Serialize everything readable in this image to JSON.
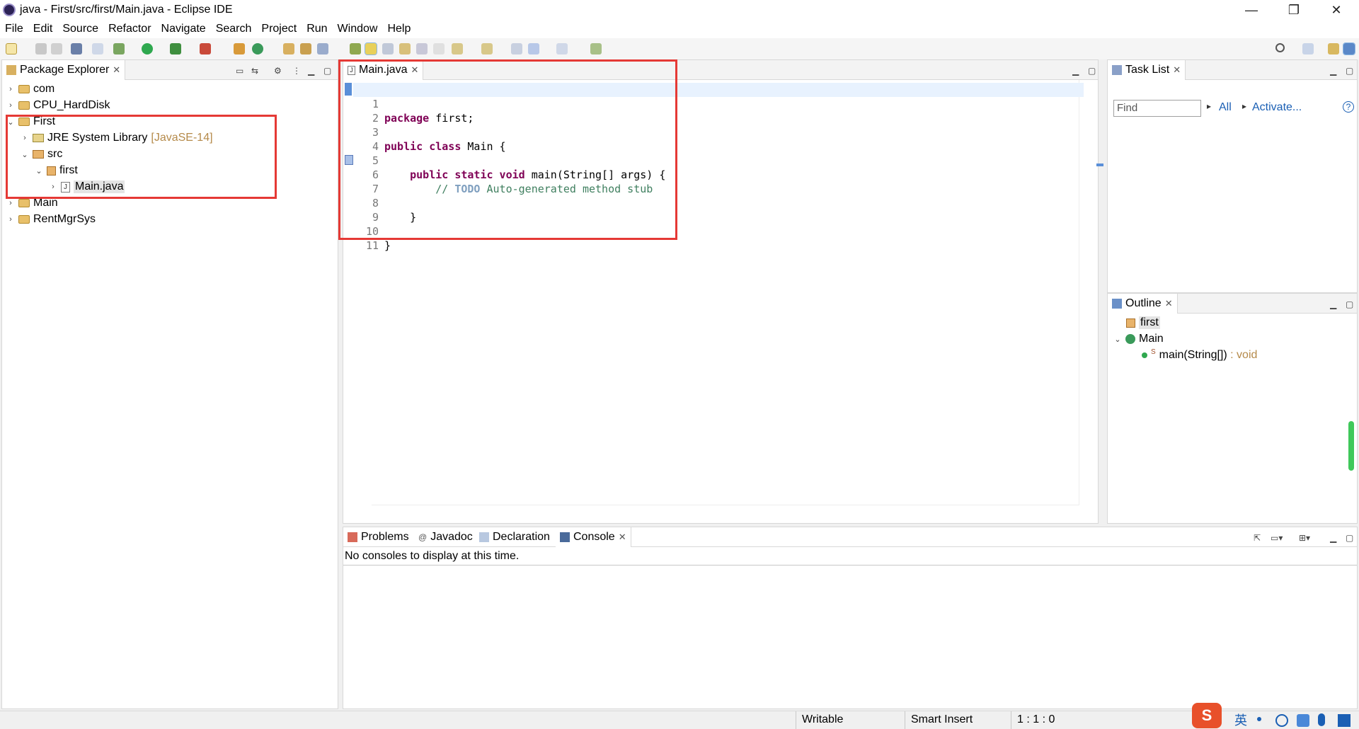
{
  "window": {
    "title": "java - First/src/first/Main.java - Eclipse IDE",
    "minimize": "—",
    "restore": "❐",
    "close": "✕"
  },
  "menu": [
    "File",
    "Edit",
    "Source",
    "Refactor",
    "Navigate",
    "Search",
    "Project",
    "Run",
    "Window",
    "Help"
  ],
  "package_explorer": {
    "tab_label": "Package Explorer",
    "items": [
      {
        "label": "com"
      },
      {
        "label": "CPU_HardDisk"
      },
      {
        "label": "First"
      },
      {
        "label": "JRE System Library",
        "decoration": "[JavaSE-14]"
      },
      {
        "label": "src"
      },
      {
        "label": "first"
      },
      {
        "label": "Main.java"
      },
      {
        "label": "Main"
      },
      {
        "label": "RentMgrSys"
      }
    ]
  },
  "editor": {
    "tab_label": "Main.java",
    "line_numbers": [
      "1",
      "2",
      "3",
      "4",
      "5",
      "6",
      "7",
      "8",
      "9",
      "10",
      "11"
    ],
    "lines": [
      {
        "kw": "package",
        "text": " first;"
      },
      {
        "kw": "",
        "text": ""
      },
      {
        "kw": "public class",
        "text": " Main {"
      },
      {
        "kw": "",
        "text": ""
      },
      {
        "indent": "    ",
        "kw": "public static void",
        "text": " main(String[] args) {"
      },
      {
        "indent": "        ",
        "comment_start": "// ",
        "comment_tag": "TODO",
        "comment_text": " Auto-generated method stub"
      },
      {
        "kw": "",
        "text": ""
      },
      {
        "kw": "",
        "text": "    }"
      },
      {
        "kw": "",
        "text": ""
      },
      {
        "kw": "",
        "text": "}"
      },
      {
        "kw": "",
        "text": ""
      }
    ]
  },
  "task_list": {
    "tab_label": "Task List",
    "find_placeholder": "Find",
    "all_label": "All",
    "activate_label": "Activate...",
    "help": "?"
  },
  "outline": {
    "tab_label": "Outline",
    "items": [
      {
        "label": "first"
      },
      {
        "label": "Main"
      },
      {
        "label": "main(String[])",
        "type": " : void",
        "modifier": "S"
      }
    ]
  },
  "bottom": {
    "tabs": [
      "Problems",
      "Javadoc",
      "Declaration",
      "Console"
    ],
    "message": "No consoles to display at this time."
  },
  "status": {
    "writable": "Writable",
    "insert_mode": "Smart Insert",
    "position": "1 : 1 : 0"
  },
  "ime": {
    "lang": "英"
  },
  "colors": {
    "keyword": "#7f0055",
    "comment": "#3f7f5f",
    "annotation_box": "#e53935",
    "decoration": "#b58a4a"
  }
}
